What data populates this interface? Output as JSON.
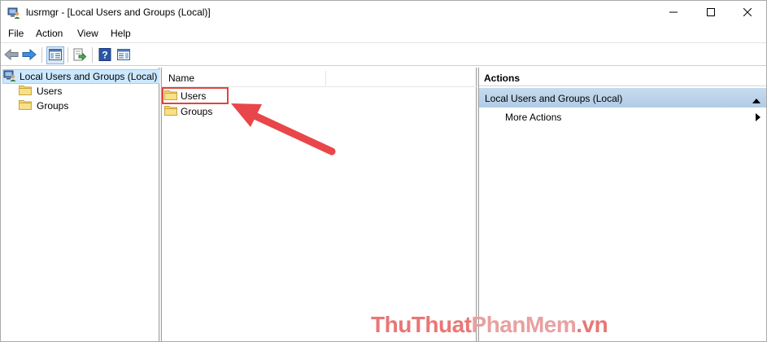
{
  "window": {
    "title": "lusrmgr - [Local Users and Groups (Local)]"
  },
  "menu": {
    "file": "File",
    "action": "Action",
    "view": "View",
    "help": "Help"
  },
  "tree": {
    "root_label": "Local Users and Groups (Local)",
    "children": [
      {
        "label": "Users"
      },
      {
        "label": "Groups"
      }
    ]
  },
  "list": {
    "column_name": "Name",
    "rows": [
      {
        "label": "Users"
      },
      {
        "label": "Groups"
      }
    ]
  },
  "actions": {
    "title": "Actions",
    "section_label": "Local Users and Groups (Local)",
    "more_actions": "More Actions"
  },
  "watermark": {
    "part1": "ThuThuat",
    "part2": "PhanMem",
    "part3": ".vn"
  },
  "colors": {
    "selection": "#cce8ff",
    "section_header": "#b9d1ea",
    "highlight_box": "#e0443e",
    "arrow": "#e8464a",
    "folder": "#f5d66b"
  },
  "icons": {
    "app": "computer-users-icon",
    "folder": "folder-icon",
    "back": "back-arrow-icon",
    "forward": "forward-arrow-icon"
  }
}
